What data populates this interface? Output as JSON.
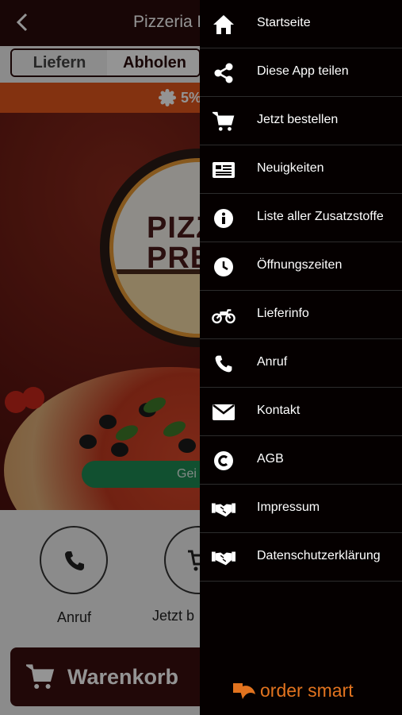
{
  "app": {
    "title": "Pizzeria P",
    "tabs": [
      "Liefern",
      "Abholen"
    ],
    "promo_text": "5%",
    "hero_logo_lines": [
      "PIZZ",
      "PRE"
    ],
    "green_button_label": "Gei",
    "quick_actions": [
      {
        "label": "Anruf",
        "icon": "phone-icon"
      },
      {
        "label": "Jetzt b",
        "icon": "cart-icon"
      }
    ],
    "cart_label": "Warenkorb"
  },
  "menu": {
    "items": [
      {
        "label": "Startseite",
        "icon": "home-icon"
      },
      {
        "label": "Diese App teilen",
        "icon": "share-icon"
      },
      {
        "label": "Jetzt bestellen",
        "icon": "cart-icon"
      },
      {
        "label": "Neuigkeiten",
        "icon": "newspaper-icon"
      },
      {
        "label": "Liste aller Zusatzstoffe",
        "icon": "info-icon"
      },
      {
        "label": "Öffnungszeiten",
        "icon": "clock-icon"
      },
      {
        "label": "Lieferinfo",
        "icon": "motorcycle-icon"
      },
      {
        "label": "Anruf",
        "icon": "phone-icon"
      },
      {
        "label": "Kontakt",
        "icon": "envelope-icon"
      },
      {
        "label": "AGB",
        "icon": "copyright-icon"
      },
      {
        "label": "Impressum",
        "icon": "handshake-icon"
      },
      {
        "label": "Datenschutzerklärung",
        "icon": "handshake-icon"
      }
    ],
    "brand": "order smart"
  },
  "colors": {
    "topbar": "#2a0b0c",
    "promo": "#e2561c",
    "drawer": "#050000",
    "brand": "#e2731f",
    "green_button": "#1e8a54"
  }
}
